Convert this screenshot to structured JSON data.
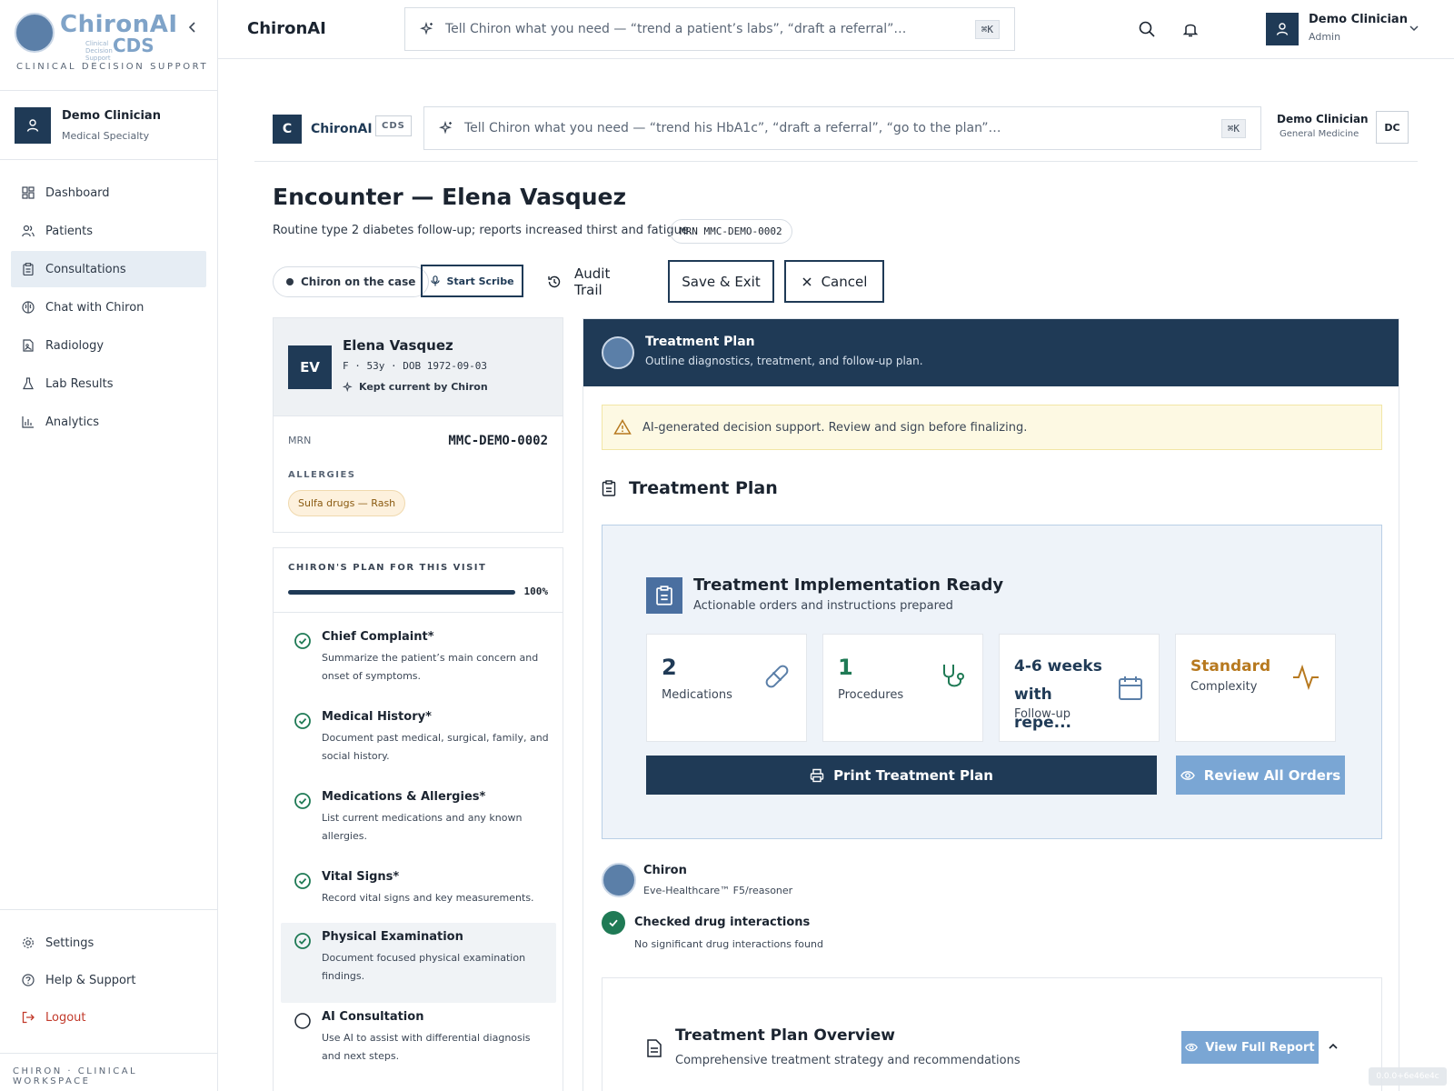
{
  "app": {
    "logo_text": "ChironAI",
    "logo_cds": "CDS",
    "logo_sub": "Clinical Decision Support",
    "caption": "CLINICAL DECISION SUPPORT",
    "footer": "CHIRON · CLINICAL WORKSPACE",
    "version": "0.0.0+6e46e4c"
  },
  "sidebar": {
    "user": {
      "name": "Demo Clinician",
      "role": "Medical Specialty"
    },
    "items": [
      {
        "label": "Dashboard",
        "icon": "dashboard-icon"
      },
      {
        "label": "Patients",
        "icon": "users-icon"
      },
      {
        "label": "Consultations",
        "icon": "clipboard-icon",
        "active": true
      },
      {
        "label": "Chat with Chiron",
        "icon": "brain-icon"
      },
      {
        "label": "Radiology",
        "icon": "file-image-icon"
      },
      {
        "label": "Lab Results",
        "icon": "flask-icon"
      },
      {
        "label": "Analytics",
        "icon": "bar-chart-icon"
      }
    ],
    "bottom": [
      {
        "label": "Settings",
        "icon": "gear-icon"
      },
      {
        "label": "Help & Support",
        "icon": "help-icon"
      },
      {
        "label": "Logout",
        "icon": "logout-icon"
      }
    ]
  },
  "topbar": {
    "brand": "ChironAI",
    "search_placeholder": "Tell Chiron what you need — “trend a patient’s labs”, “draft a referral”…",
    "shortcut": "⌘K",
    "user": {
      "name": "Demo Clinician",
      "role": "Admin"
    }
  },
  "bar2": {
    "badge": "C",
    "brand": "ChironAI",
    "tag": "CDS",
    "search_placeholder": "Tell Chiron what you need — “trend his HbA1c”, “draft a referral”, “go to the plan”…",
    "shortcut": "⌘K",
    "user": {
      "name": "Demo Clinician",
      "role": "General Medicine",
      "initials": "DC"
    }
  },
  "encounter": {
    "title": "Encounter — Elena Vasquez",
    "subtitle": "Routine type 2 diabetes follow-up; reports increased thirst and fatigue.",
    "mrn_pill": "MRN MMC-DEMO-0002"
  },
  "actions": {
    "chiron": "Chiron on the case",
    "scribe": "Start Scribe",
    "audit": "Audit Trail",
    "save": "Save & Exit",
    "cancel": "Cancel"
  },
  "patient": {
    "initials": "EV",
    "name": "Elena Vasquez",
    "meta": "F · 53y · DOB 1972-09-03",
    "kept": "Kept current by Chiron",
    "mrn_label": "MRN",
    "mrn": "MMC-DEMO-0002",
    "allergies_label": "ALLERGIES",
    "allergy": "Sulfa drugs — Rash"
  },
  "plan": {
    "title": "CHIRON'S PLAN FOR THIS VISIT",
    "progress": 1.0,
    "progress_label": "100%",
    "steps": [
      {
        "title": "Chief Complaint",
        "req": "*",
        "desc": "Summarize the patient’s main concern and onset of symptoms.",
        "done": true
      },
      {
        "title": "Medical History",
        "req": "*",
        "desc": "Document past medical, surgical, family, and social history.",
        "done": true
      },
      {
        "title": "Medications & Allergies",
        "req": "*",
        "desc": "List current medications and any known allergies.",
        "done": true
      },
      {
        "title": "Vital Signs",
        "req": "*",
        "desc": "Record vital signs and key measurements.",
        "done": true
      },
      {
        "title": "Physical Examination",
        "req": "",
        "desc": "Document focused physical examination findings.",
        "done": true
      },
      {
        "title": "AI Consultation",
        "req": "",
        "desc": "Use AI to assist with differential diagnosis and next steps.",
        "done": false
      }
    ]
  },
  "treatment": {
    "header_title": "Treatment Plan",
    "header_sub": "Outline diagnostics, treatment, and follow-up plan.",
    "warning": "AI-generated decision support. Review and sign before finalizing.",
    "section_title": "Treatment Plan",
    "ready_title": "Treatment Implementation Ready",
    "ready_sub": "Actionable orders and instructions prepared",
    "stats": [
      {
        "value": "2",
        "label": "Medications",
        "color": "#1f3a56"
      },
      {
        "value": "1",
        "label": "Procedures",
        "color": "#1f7a55"
      },
      {
        "value": "4-6 weeks with repe...",
        "label": "Follow-up",
        "color": "#1f3a56"
      },
      {
        "value": "Standard",
        "label": "Complexity",
        "color": "#b7791f"
      }
    ],
    "print": "Print Treatment Plan",
    "review": "Review All Orders",
    "chiron_name": "Chiron",
    "model": "Eve-Healthcare™ F5/reasoner",
    "check_title": "Checked drug interactions",
    "check_sub": "No significant drug interactions found",
    "overview_title": "Treatment Plan Overview",
    "overview_sub": "Comprehensive treatment strategy and recommendations",
    "view_report": "View Full Report"
  }
}
